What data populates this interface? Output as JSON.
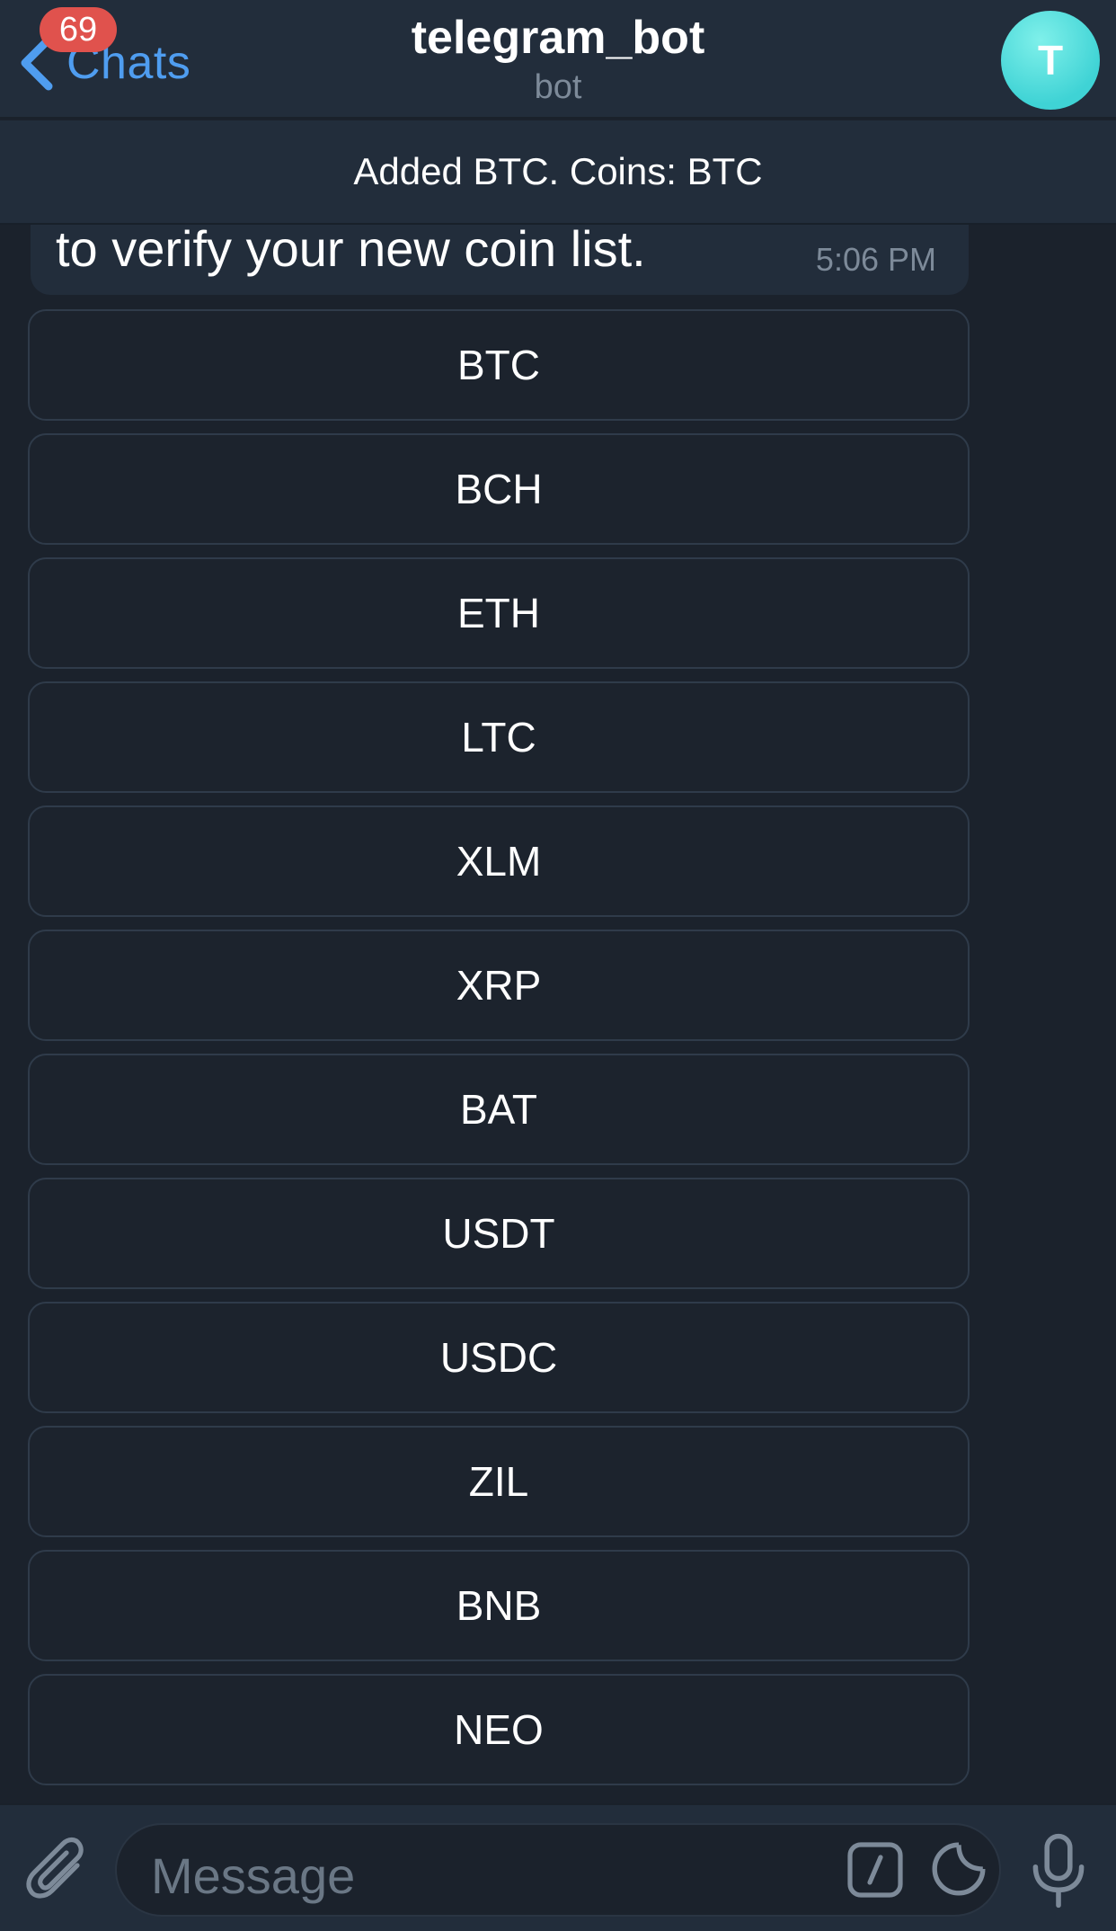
{
  "header": {
    "back_label": "Chats",
    "unread_badge": "69",
    "title": "telegram_bot",
    "subtitle": "bot",
    "avatar_letter": "T"
  },
  "pinned": {
    "text": "Added BTC. Coins: BTC"
  },
  "message": {
    "text": "to verify your new coin list.",
    "time": "5:06 PM"
  },
  "keyboard": {
    "buttons": [
      "BTC",
      "BCH",
      "ETH",
      "LTC",
      "XLM",
      "XRP",
      "BAT",
      "USDT",
      "USDC",
      "ZIL",
      "BNB",
      "NEO"
    ]
  },
  "composer": {
    "placeholder": "Message"
  },
  "icons": {
    "back": "chevron-left-icon",
    "attach": "paperclip-icon",
    "command": "slash-command-icon",
    "sticker": "sticker-icon",
    "mic": "microphone-icon"
  },
  "colors": {
    "accent": "#4f9df0",
    "badge": "#e0524d",
    "avatar": "#3fd3d5",
    "background": "#1b222c",
    "bar": "#222d3b"
  }
}
